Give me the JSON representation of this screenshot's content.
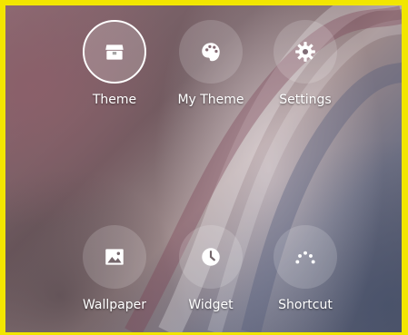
{
  "menu": {
    "items": [
      {
        "label": "Theme",
        "icon": "theme-store-icon",
        "selected": true
      },
      {
        "label": "My Theme",
        "icon": "palette-icon"
      },
      {
        "label": "Settings",
        "icon": "gear-icon"
      },
      {
        "label": "Wallpaper",
        "icon": "image-icon"
      },
      {
        "label": "Widget",
        "icon": "clock-icon"
      },
      {
        "label": "Shortcut",
        "icon": "dots-arc-icon"
      }
    ]
  },
  "colors": {
    "frame_border": "#f2e600",
    "icon": "#ffffff",
    "label": "#ffffff"
  }
}
